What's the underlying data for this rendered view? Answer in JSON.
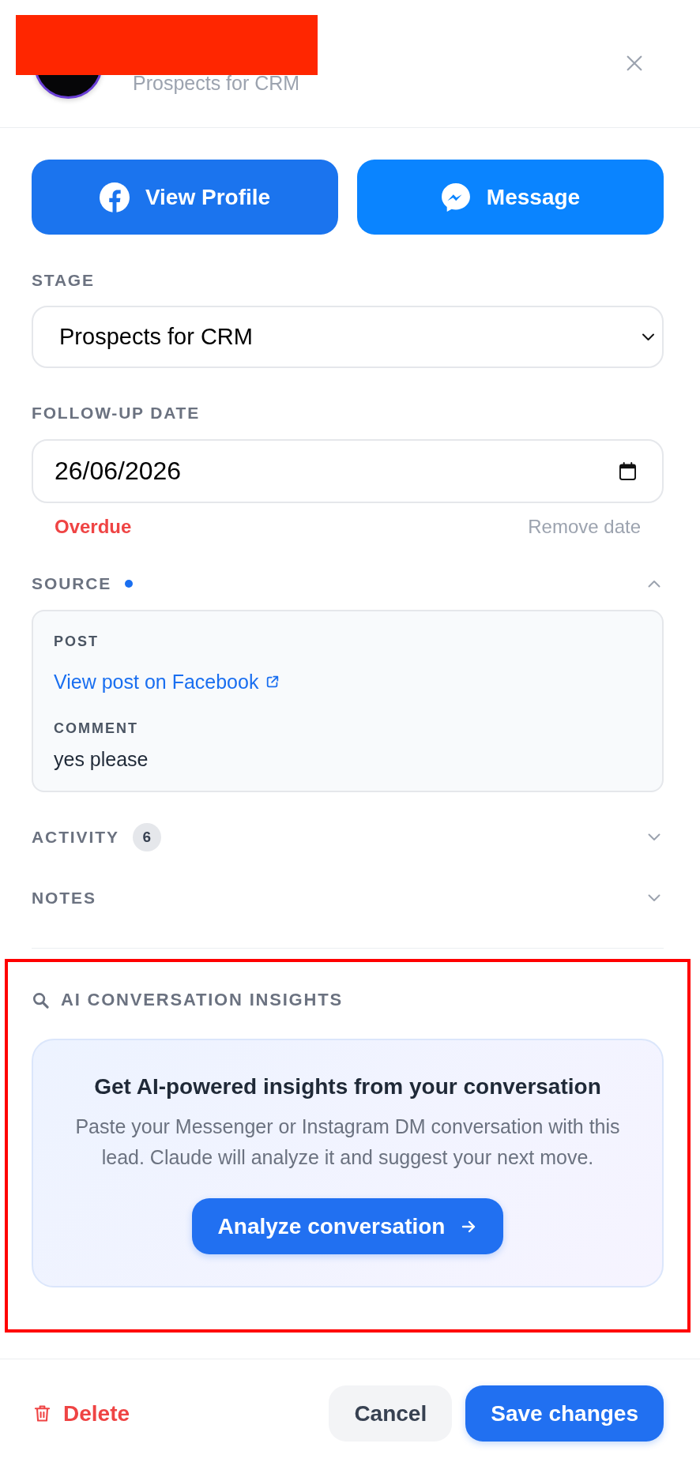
{
  "header": {
    "name_redacted": true,
    "subtitle": "Prospects for CRM"
  },
  "actions": [
    {
      "kind": "facebook",
      "label": "View Profile"
    },
    {
      "kind": "messenger",
      "label": "Message"
    }
  ],
  "stage": {
    "label": "STAGE",
    "value": "Prospects for CRM"
  },
  "follow_up": {
    "label": "FOLLOW-UP DATE",
    "value": "26/06/2026",
    "status": "Overdue",
    "remove": "Remove date"
  },
  "sections": [
    {
      "title": "SOURCE",
      "indicator": true,
      "expanded": true,
      "fields": [
        {
          "kind": "link",
          "label": "POST",
          "value": "View post on Facebook"
        },
        {
          "kind": "text",
          "label": "COMMENT",
          "value": "yes please"
        }
      ]
    },
    {
      "title": "ACTIVITY",
      "indicator": false,
      "count": "6",
      "expanded": false
    },
    {
      "title": "NOTES",
      "indicator": false,
      "expanded": false
    }
  ],
  "ai_insights": {
    "title": "AI CONVERSATION INSIGHTS",
    "highlighted": true,
    "card": {
      "heading": "Get AI-powered insights from your conversation",
      "text": "Paste your Messenger or Instagram DM conversation with this lead. Claude will analyze it and suggest your next move.",
      "button": "Analyze conversation"
    }
  },
  "footer": {
    "buttons": [
      {
        "kind": "delete",
        "label": "Delete"
      },
      {
        "kind": "cancel",
        "label": "Cancel"
      },
      {
        "kind": "save",
        "label": "Save changes"
      }
    ]
  }
}
